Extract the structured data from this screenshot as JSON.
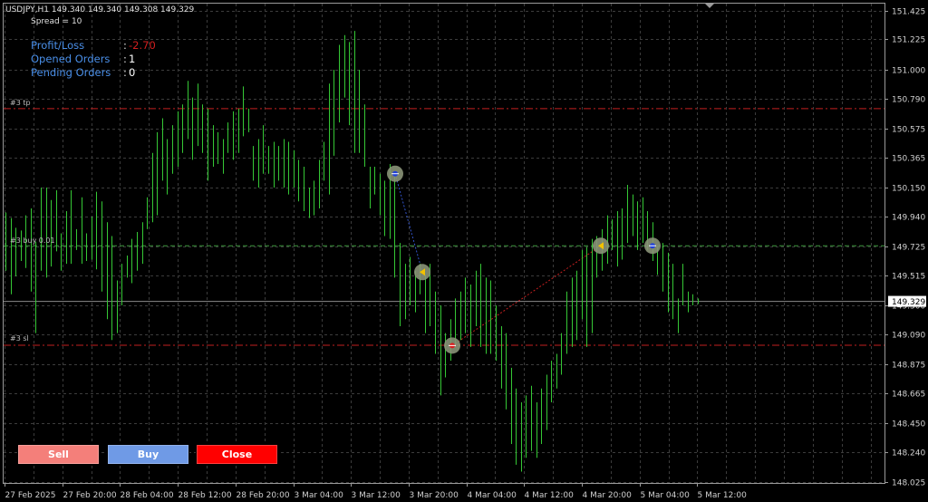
{
  "header": {
    "symbol_line": "USDJPY,H1  149.340 149.340 149.308 149.329",
    "spread": "Spread = 10"
  },
  "info": [
    {
      "label": "Profit/Loss",
      "value": "-2.70",
      "color": "#d11f1f"
    },
    {
      "label": "Opened Orders",
      "value": "1",
      "color": "#ffffff"
    },
    {
      "label": "Pending Orders",
      "value": "0",
      "color": "#ffffff"
    }
  ],
  "buttons": {
    "sell": {
      "label": "Sell",
      "color": "#f47f7a"
    },
    "buy": {
      "label": "Buy",
      "color": "#6f9ae6"
    },
    "close": {
      "label": "Close",
      "color": "#ff0000"
    }
  },
  "levels": {
    "tp": {
      "label": "#3 tp",
      "price": 150.72,
      "color": "#c21f1f"
    },
    "buy": {
      "label": "#3 buy 0.01",
      "price": 149.73,
      "color": "#3f9b3f"
    },
    "sl": {
      "label": "#3 sl",
      "price": 149.012,
      "color": "#c21f1f"
    },
    "current": {
      "label": "149.329",
      "price": 149.329,
      "color": "#8a8a8a"
    }
  },
  "chart_data": {
    "type": "ohlc",
    "symbol": "USDJPY",
    "timeframe": "H1",
    "bar_color": "#35c835",
    "ylim": [
      148.025,
      151.425
    ],
    "y_ticks": [
      "151.425",
      "151.225",
      "151.000",
      "150.790",
      "150.575",
      "150.365",
      "150.150",
      "149.940",
      "149.725",
      "149.515",
      "149.300",
      "149.090",
      "148.875",
      "148.665",
      "148.450",
      "148.240",
      "148.025"
    ],
    "x_ticks": [
      "27 Feb 2025",
      "27 Feb 20:00",
      "28 Feb 04:00",
      "28 Feb 12:00",
      "28 Feb 20:00",
      "3 Mar 04:00",
      "3 Mar 12:00",
      "3 Mar 20:00",
      "4 Mar 04:00",
      "4 Mar 12:00",
      "4 Mar 20:00",
      "5 Mar 04:00",
      "5 Mar 12:00"
    ],
    "bars": [
      {
        "h": 149.97,
        "l": 149.55
      },
      {
        "h": 149.93,
        "l": 149.38
      },
      {
        "h": 149.86,
        "l": 149.51
      },
      {
        "h": 149.84,
        "l": 149.62
      },
      {
        "h": 149.95,
        "l": 149.57
      },
      {
        "h": 150.0,
        "l": 149.4
      },
      {
        "h": 149.76,
        "l": 149.1
      },
      {
        "h": 150.15,
        "l": 149.55
      },
      {
        "h": 150.15,
        "l": 149.5
      },
      {
        "h": 150.06,
        "l": 149.58
      },
      {
        "h": 150.13,
        "l": 149.69
      },
      {
        "h": 149.82,
        "l": 149.55
      },
      {
        "h": 149.98,
        "l": 149.6
      },
      {
        "h": 150.13,
        "l": 149.6
      },
      {
        "h": 149.85,
        "l": 149.7
      },
      {
        "h": 150.08,
        "l": 149.6
      },
      {
        "h": 149.82,
        "l": 149.62
      },
      {
        "h": 149.94,
        "l": 149.63
      },
      {
        "h": 150.12,
        "l": 149.56
      },
      {
        "h": 150.05,
        "l": 149.4
      },
      {
        "h": 149.9,
        "l": 149.2
      },
      {
        "h": 149.8,
        "l": 149.05
      },
      {
        "h": 149.48,
        "l": 149.1
      },
      {
        "h": 149.6,
        "l": 149.3
      },
      {
        "h": 149.66,
        "l": 149.5
      },
      {
        "h": 149.78,
        "l": 149.46
      },
      {
        "h": 149.83,
        "l": 149.55
      },
      {
        "h": 149.9,
        "l": 149.6
      },
      {
        "h": 150.08,
        "l": 149.85
      },
      {
        "h": 150.4,
        "l": 149.9
      },
      {
        "h": 150.55,
        "l": 149.95
      },
      {
        "h": 150.65,
        "l": 150.2
      },
      {
        "h": 150.5,
        "l": 150.1
      },
      {
        "h": 150.6,
        "l": 150.25
      },
      {
        "h": 150.7,
        "l": 150.3
      },
      {
        "h": 150.75,
        "l": 150.4
      },
      {
        "h": 150.92,
        "l": 150.5
      },
      {
        "h": 150.8,
        "l": 150.35
      },
      {
        "h": 150.9,
        "l": 150.45
      },
      {
        "h": 150.75,
        "l": 150.4
      },
      {
        "h": 150.72,
        "l": 150.2
      },
      {
        "h": 150.6,
        "l": 150.3
      },
      {
        "h": 150.55,
        "l": 150.32
      },
      {
        "h": 150.5,
        "l": 150.25
      },
      {
        "h": 150.62,
        "l": 150.4
      },
      {
        "h": 150.7,
        "l": 150.35
      },
      {
        "h": 150.72,
        "l": 150.4
      },
      {
        "h": 150.88,
        "l": 150.52
      },
      {
        "h": 150.72,
        "l": 150.55
      },
      {
        "h": 150.45,
        "l": 150.2
      },
      {
        "h": 150.5,
        "l": 150.15
      },
      {
        "h": 150.6,
        "l": 150.25
      },
      {
        "h": 150.45,
        "l": 150.25
      },
      {
        "h": 150.48,
        "l": 150.15
      },
      {
        "h": 150.45,
        "l": 150.2
      },
      {
        "h": 150.5,
        "l": 150.15
      },
      {
        "h": 150.48,
        "l": 150.1
      },
      {
        "h": 150.42,
        "l": 150.15
      },
      {
        "h": 150.35,
        "l": 150.05
      },
      {
        "h": 150.3,
        "l": 149.98
      },
      {
        "h": 150.15,
        "l": 149.93
      },
      {
        "h": 150.2,
        "l": 149.95
      },
      {
        "h": 150.35,
        "l": 150.0
      },
      {
        "h": 150.48,
        "l": 150.2
      },
      {
        "h": 150.9,
        "l": 150.1
      },
      {
        "h": 151.0,
        "l": 150.38
      },
      {
        "h": 151.18,
        "l": 150.62
      },
      {
        "h": 151.25,
        "l": 150.8
      },
      {
        "h": 151.2,
        "l": 150.6
      },
      {
        "h": 151.28,
        "l": 150.4
      },
      {
        "h": 151.0,
        "l": 150.4
      },
      {
        "h": 150.75,
        "l": 150.3
      },
      {
        "h": 150.3,
        "l": 150.0
      },
      {
        "h": 150.3,
        "l": 150.1
      },
      {
        "h": 150.25,
        "l": 149.95
      },
      {
        "h": 150.2,
        "l": 149.8
      },
      {
        "h": 150.32,
        "l": 149.78
      },
      {
        "h": 150.25,
        "l": 149.5
      },
      {
        "h": 149.75,
        "l": 149.15
      },
      {
        "h": 149.6,
        "l": 149.2
      },
      {
        "h": 149.65,
        "l": 149.3
      },
      {
        "h": 149.55,
        "l": 149.25
      },
      {
        "h": 149.6,
        "l": 149.38
      },
      {
        "h": 149.52,
        "l": 149.1
      },
      {
        "h": 149.6,
        "l": 149.15
      },
      {
        "h": 149.4,
        "l": 148.95
      },
      {
        "h": 149.3,
        "l": 148.65
      },
      {
        "h": 149.1,
        "l": 148.78
      },
      {
        "h": 149.2,
        "l": 148.9
      },
      {
        "h": 149.35,
        "l": 149.0
      },
      {
        "h": 149.4,
        "l": 149.05
      },
      {
        "h": 149.5,
        "l": 149.1
      },
      {
        "h": 149.45,
        "l": 149.0
      },
      {
        "h": 149.55,
        "l": 149.15
      },
      {
        "h": 149.6,
        "l": 149.0
      },
      {
        "h": 149.5,
        "l": 148.95
      },
      {
        "h": 149.48,
        "l": 148.95
      },
      {
        "h": 149.3,
        "l": 148.9
      },
      {
        "h": 149.15,
        "l": 148.7
      },
      {
        "h": 149.1,
        "l": 148.55
      },
      {
        "h": 148.85,
        "l": 148.3
      },
      {
        "h": 148.7,
        "l": 148.15
      },
      {
        "h": 148.6,
        "l": 148.1
      },
      {
        "h": 148.65,
        "l": 148.2
      },
      {
        "h": 148.72,
        "l": 148.25
      },
      {
        "h": 148.6,
        "l": 148.2
      },
      {
        "h": 148.7,
        "l": 148.3
      },
      {
        "h": 148.8,
        "l": 148.4
      },
      {
        "h": 148.9,
        "l": 148.6
      },
      {
        "h": 148.95,
        "l": 148.7
      },
      {
        "h": 149.1,
        "l": 148.8
      },
      {
        "h": 149.4,
        "l": 148.95
      },
      {
        "h": 149.5,
        "l": 149.0
      },
      {
        "h": 149.55,
        "l": 149.05
      },
      {
        "h": 149.7,
        "l": 149.2
      },
      {
        "h": 149.72,
        "l": 149.0
      },
      {
        "h": 149.78,
        "l": 149.1
      },
      {
        "h": 149.8,
        "l": 149.5
      },
      {
        "h": 149.85,
        "l": 149.55
      },
      {
        "h": 149.95,
        "l": 149.6
      },
      {
        "h": 149.92,
        "l": 149.7
      },
      {
        "h": 149.98,
        "l": 149.58
      },
      {
        "h": 150.0,
        "l": 149.63
      },
      {
        "h": 150.17,
        "l": 149.75
      },
      {
        "h": 150.1,
        "l": 149.8
      },
      {
        "h": 150.05,
        "l": 149.7
      },
      {
        "h": 150.08,
        "l": 149.75
      },
      {
        "h": 149.98,
        "l": 149.7
      },
      {
        "h": 149.9,
        "l": 149.62
      },
      {
        "h": 149.72,
        "l": 149.52
      },
      {
        "h": 149.75,
        "l": 149.4
      },
      {
        "h": 149.68,
        "l": 149.25
      },
      {
        "h": 149.6,
        "l": 149.2
      },
      {
        "h": 149.35,
        "l": 149.1
      },
      {
        "h": 149.6,
        "l": 149.3
      },
      {
        "h": 149.4,
        "l": 149.25
      },
      {
        "h": 149.38,
        "l": 149.3
      },
      {
        "h": 149.35,
        "l": 149.31
      }
    ]
  }
}
